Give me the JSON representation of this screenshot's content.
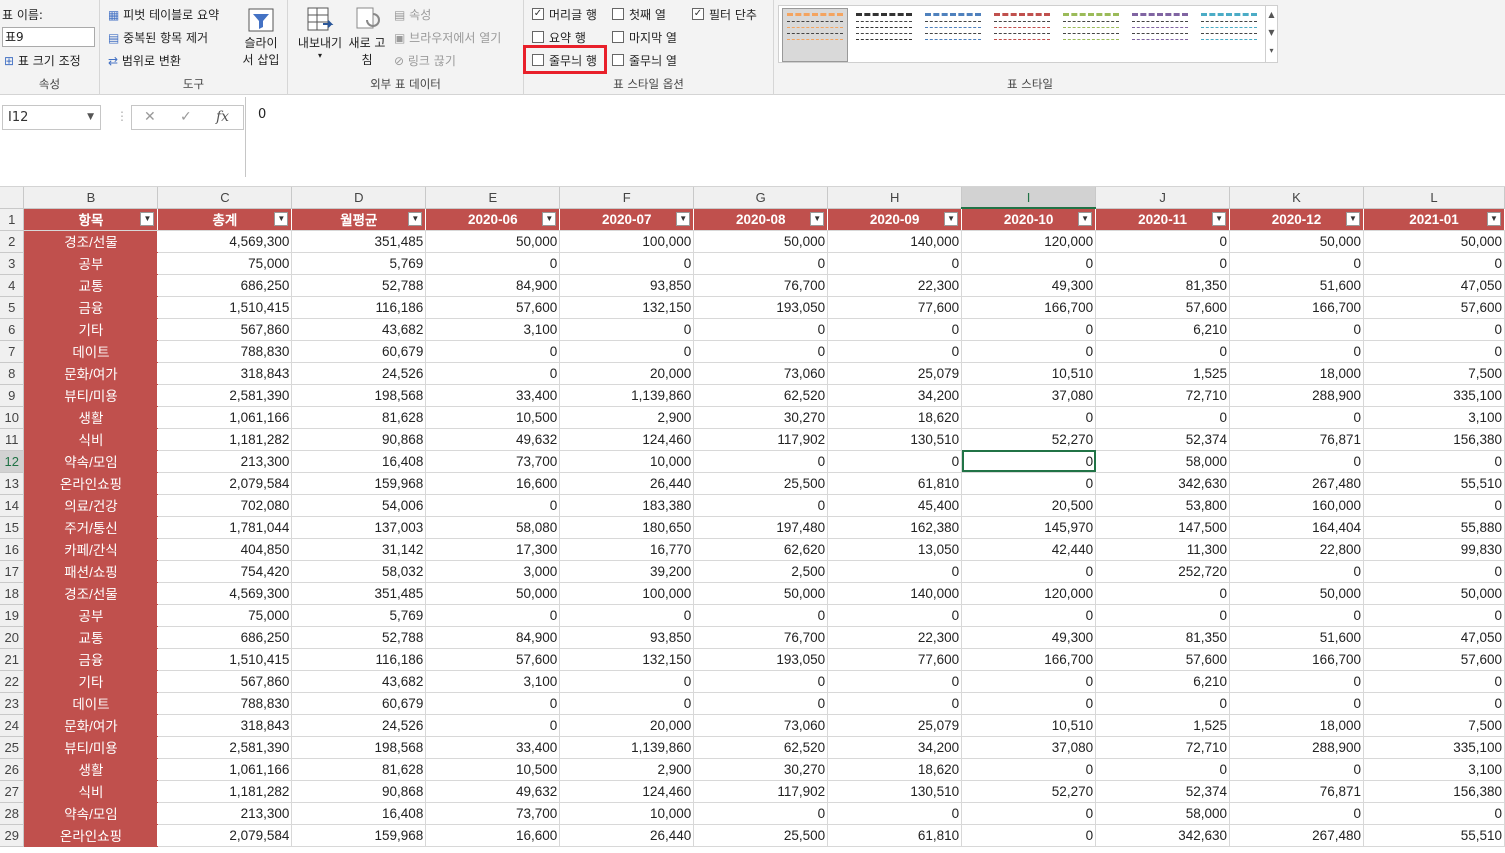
{
  "ribbon": {
    "props": {
      "name_label": "표 이름:",
      "name_value": "표9",
      "resize": "표 크기 조정",
      "group": "속성"
    },
    "tools": {
      "pivot": "피벗 테이블로 요약",
      "dedupe": "중복된 항목 제거",
      "convert": "범위로 변환",
      "slicer_line1": "슬라이",
      "slicer_line2": "서 삽입",
      "group": "도구"
    },
    "external": {
      "export_line1": "내보내기",
      "refresh_line1": "새로 고",
      "refresh_line2": "침",
      "properties": "속성",
      "open_browser": "브라우저에서 열기",
      "unlink": "링크 끊기",
      "group": "외부 표 데이터"
    },
    "style_options": {
      "header_row": "머리글 행",
      "first_col": "첫째 열",
      "filter_btn": "필터 단추",
      "total_row": "요약 행",
      "last_col": "마지막 열",
      "banded_rows": "줄무늬 행",
      "banded_cols": "줄무늬 열",
      "group": "표 스타일 옵션"
    },
    "styles": {
      "group": "표 스타일",
      "swatch_colors": [
        "#f4a460",
        "#333333",
        "#4f81bd",
        "#c0504d",
        "#9bbb59",
        "#8064a2",
        "#4bacc6"
      ]
    }
  },
  "formula_bar": {
    "cell_ref": "I12",
    "value": "0"
  },
  "columns": [
    "B",
    "C",
    "D",
    "E",
    "F",
    "G",
    "H",
    "I",
    "J",
    "K",
    "L"
  ],
  "header": [
    "항목",
    "총계",
    "월평균",
    "2020-06",
    "2020-07",
    "2020-08",
    "2020-09",
    "2020-10",
    "2020-11",
    "2020-12",
    "2021-01"
  ],
  "rows": [
    {
      "n": "2",
      "cells": [
        "경조/선물",
        "4,569,300",
        "351,485",
        "50,000",
        "100,000",
        "50,000",
        "140,000",
        "120,000",
        "0",
        "50,000",
        "50,000"
      ]
    },
    {
      "n": "3",
      "cells": [
        "공부",
        "75,000",
        "5,769",
        "0",
        "0",
        "0",
        "0",
        "0",
        "0",
        "0",
        "0"
      ]
    },
    {
      "n": "4",
      "cells": [
        "교통",
        "686,250",
        "52,788",
        "84,900",
        "93,850",
        "76,700",
        "22,300",
        "49,300",
        "81,350",
        "51,600",
        "47,050"
      ]
    },
    {
      "n": "5",
      "cells": [
        "금융",
        "1,510,415",
        "116,186",
        "57,600",
        "132,150",
        "193,050",
        "77,600",
        "166,700",
        "57,600",
        "166,700",
        "57,600"
      ]
    },
    {
      "n": "6",
      "cells": [
        "기타",
        "567,860",
        "43,682",
        "3,100",
        "0",
        "0",
        "0",
        "0",
        "6,210",
        "0",
        "0"
      ]
    },
    {
      "n": "7",
      "cells": [
        "데이트",
        "788,830",
        "60,679",
        "0",
        "0",
        "0",
        "0",
        "0",
        "0",
        "0",
        "0"
      ]
    },
    {
      "n": "8",
      "cells": [
        "문화/여가",
        "318,843",
        "24,526",
        "0",
        "20,000",
        "73,060",
        "25,079",
        "10,510",
        "1,525",
        "18,000",
        "7,500"
      ]
    },
    {
      "n": "9",
      "cells": [
        "뷰티/미용",
        "2,581,390",
        "198,568",
        "33,400",
        "1,139,860",
        "62,520",
        "34,200",
        "37,080",
        "72,710",
        "288,900",
        "335,100"
      ]
    },
    {
      "n": "10",
      "cells": [
        "생활",
        "1,061,166",
        "81,628",
        "10,500",
        "2,900",
        "30,270",
        "18,620",
        "0",
        "0",
        "0",
        "3,100"
      ]
    },
    {
      "n": "11",
      "cells": [
        "식비",
        "1,181,282",
        "90,868",
        "49,632",
        "124,460",
        "117,902",
        "130,510",
        "52,270",
        "52,374",
        "76,871",
        "156,380"
      ]
    },
    {
      "n": "12",
      "cells": [
        "약속/모임",
        "213,300",
        "16,408",
        "73,700",
        "10,000",
        "0",
        "0",
        "0",
        "58,000",
        "0",
        "0"
      ]
    },
    {
      "n": "13",
      "cells": [
        "온라인쇼핑",
        "2,079,584",
        "159,968",
        "16,600",
        "26,440",
        "25,500",
        "61,810",
        "0",
        "342,630",
        "267,480",
        "55,510"
      ]
    },
    {
      "n": "14",
      "cells": [
        "의료/건강",
        "702,080",
        "54,006",
        "0",
        "183,380",
        "0",
        "45,400",
        "20,500",
        "53,800",
        "160,000",
        "0"
      ]
    },
    {
      "n": "15",
      "cells": [
        "주거/통신",
        "1,781,044",
        "137,003",
        "58,080",
        "180,650",
        "197,480",
        "162,380",
        "145,970",
        "147,500",
        "164,404",
        "55,880"
      ]
    },
    {
      "n": "16",
      "cells": [
        "카페/간식",
        "404,850",
        "31,142",
        "17,300",
        "16,770",
        "62,620",
        "13,050",
        "42,440",
        "11,300",
        "22,800",
        "99,830"
      ]
    },
    {
      "n": "17",
      "cells": [
        "패션/쇼핑",
        "754,420",
        "58,032",
        "3,000",
        "39,200",
        "2,500",
        "0",
        "0",
        "252,720",
        "0",
        "0"
      ]
    },
    {
      "n": "18",
      "cells": [
        "경조/선물",
        "4,569,300",
        "351,485",
        "50,000",
        "100,000",
        "50,000",
        "140,000",
        "120,000",
        "0",
        "50,000",
        "50,000"
      ]
    },
    {
      "n": "19",
      "cells": [
        "공부",
        "75,000",
        "5,769",
        "0",
        "0",
        "0",
        "0",
        "0",
        "0",
        "0",
        "0"
      ]
    },
    {
      "n": "20",
      "cells": [
        "교통",
        "686,250",
        "52,788",
        "84,900",
        "93,850",
        "76,700",
        "22,300",
        "49,300",
        "81,350",
        "51,600",
        "47,050"
      ]
    },
    {
      "n": "21",
      "cells": [
        "금융",
        "1,510,415",
        "116,186",
        "57,600",
        "132,150",
        "193,050",
        "77,600",
        "166,700",
        "57,600",
        "166,700",
        "57,600"
      ]
    },
    {
      "n": "22",
      "cells": [
        "기타",
        "567,860",
        "43,682",
        "3,100",
        "0",
        "0",
        "0",
        "0",
        "6,210",
        "0",
        "0"
      ]
    },
    {
      "n": "23",
      "cells": [
        "데이트",
        "788,830",
        "60,679",
        "0",
        "0",
        "0",
        "0",
        "0",
        "0",
        "0",
        "0"
      ]
    },
    {
      "n": "24",
      "cells": [
        "문화/여가",
        "318,843",
        "24,526",
        "0",
        "20,000",
        "73,060",
        "25,079",
        "10,510",
        "1,525",
        "18,000",
        "7,500"
      ]
    },
    {
      "n": "25",
      "cells": [
        "뷰티/미용",
        "2,581,390",
        "198,568",
        "33,400",
        "1,139,860",
        "62,520",
        "34,200",
        "37,080",
        "72,710",
        "288,900",
        "335,100"
      ]
    },
    {
      "n": "26",
      "cells": [
        "생활",
        "1,061,166",
        "81,628",
        "10,500",
        "2,900",
        "30,270",
        "18,620",
        "0",
        "0",
        "0",
        "3,100"
      ]
    },
    {
      "n": "27",
      "cells": [
        "식비",
        "1,181,282",
        "90,868",
        "49,632",
        "124,460",
        "117,902",
        "130,510",
        "52,270",
        "52,374",
        "76,871",
        "156,380"
      ]
    },
    {
      "n": "28",
      "cells": [
        "약속/모임",
        "213,300",
        "16,408",
        "73,700",
        "10,000",
        "0",
        "0",
        "0",
        "58,000",
        "0",
        "0"
      ]
    },
    {
      "n": "29",
      "cells": [
        "온라인쇼핑",
        "2,079,584",
        "159,968",
        "16,600",
        "26,440",
        "25,500",
        "61,810",
        "0",
        "342,630",
        "267,480",
        "55,510"
      ]
    }
  ]
}
